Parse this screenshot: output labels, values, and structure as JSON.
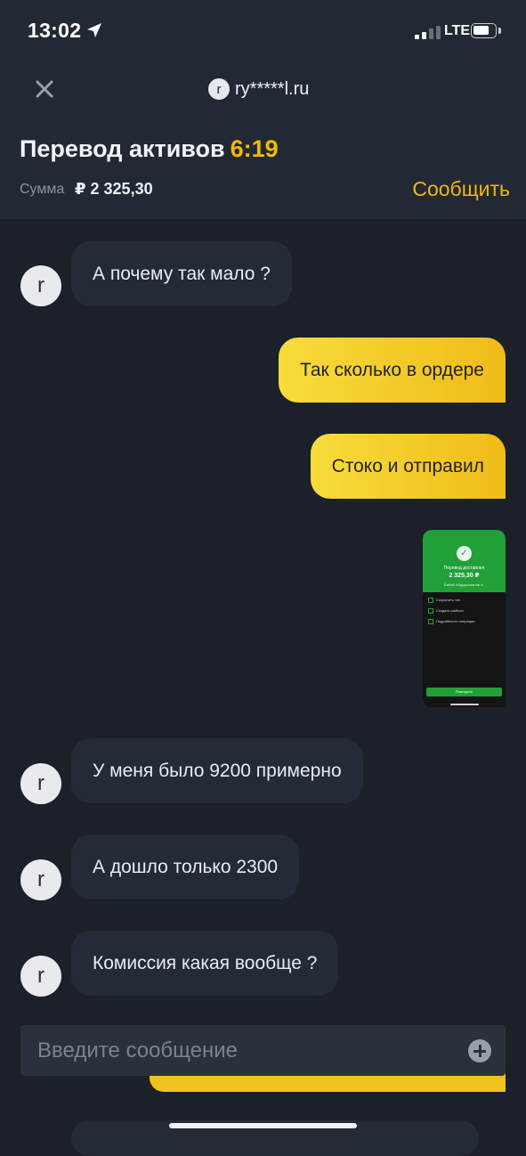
{
  "status_bar": {
    "time": "13:02",
    "network": "LTE"
  },
  "header": {
    "contact_initial": "r",
    "contact_name": "ry*****l.ru",
    "title": "Перевод активов",
    "timer": "6:19",
    "sum_label": "Сумма",
    "sum_value": "₽ 2 325,30",
    "report_label": "Сообщить"
  },
  "messages": [
    {
      "direction": "in",
      "avatar": "r",
      "text": "А почему так мало ?"
    },
    {
      "direction": "out",
      "text": "Так сколько в ордере"
    },
    {
      "direction": "out",
      "text": "Стоко и отправил"
    },
    {
      "direction": "out",
      "type": "image"
    },
    {
      "direction": "in",
      "avatar": "r",
      "text": "У меня было 9200 примерно"
    },
    {
      "direction": "in",
      "avatar": "r",
      "text": "А дошло только 2300"
    },
    {
      "direction": "in",
      "avatar": "r",
      "text": "Комиссия какая вообще ?"
    }
  ],
  "thumbnail": {
    "title": "Перевод доставлен",
    "amount": "2 325,30 ₽",
    "recipient": "Бабий Абдурахманов А.",
    "rows": [
      "Сохранить чек",
      "Создать шаблон",
      "Подробности операции"
    ],
    "button": "Повторить"
  },
  "composer": {
    "placeholder": "Введите сообщение"
  },
  "colors": {
    "accent": "#f0b90b",
    "background": "#1b2029",
    "header": "#232934",
    "bubble_in": "#252b36"
  }
}
